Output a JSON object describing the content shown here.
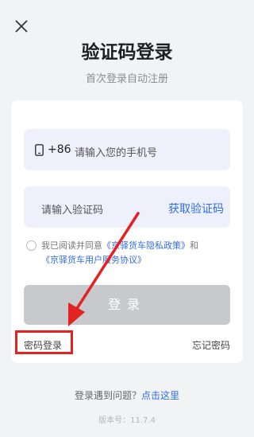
{
  "header": {
    "title": "验证码登录",
    "subtitle": "首次登录自动注册"
  },
  "form": {
    "country_code": "+86",
    "phone_placeholder": "请输入您的手机号",
    "code_placeholder": "请输入验证码",
    "get_code_label": "获取验证码",
    "agree_prefix": "我已阅读并同意",
    "privacy_link": "《京驿货车隐私政策》",
    "agree_and": "和",
    "service_link": "《京驿货车用户服务协议》",
    "login_button": "登录",
    "password_login": "密码登录",
    "forgot_password": "忘记密码"
  },
  "footer": {
    "help_prefix": "登录遇到问题？",
    "help_link": "点击这里",
    "version": "版本号：11.7.4"
  },
  "colors": {
    "accent": "#2f6ee5",
    "annotation": "#e32222",
    "disabled_button": "#c8c9cc"
  }
}
